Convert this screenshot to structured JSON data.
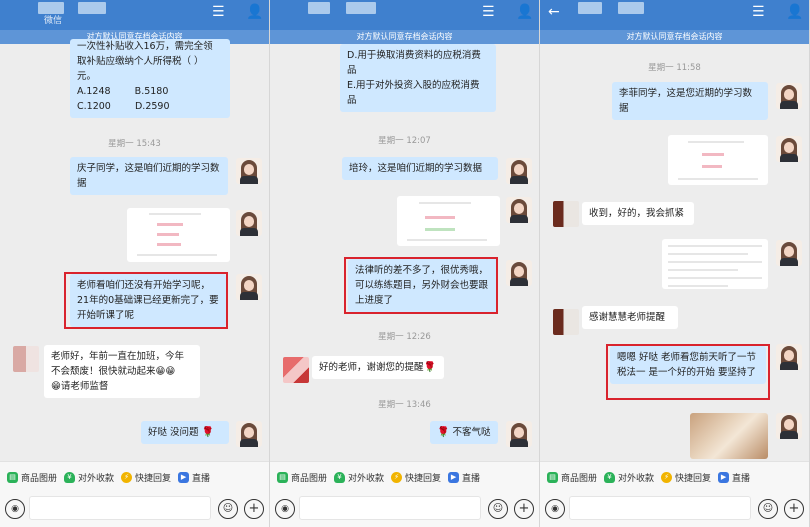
{
  "topbar": {
    "title1": "微信",
    "notice": "对方默认同意存档会话内容"
  },
  "panel1": {
    "q_lines": [
      "一次性补贴收入16万，需完全领",
      "取补贴应缴纳个人所得税（ ）",
      "元。",
      "A.1248        B.5180",
      "C.1200        D.2590"
    ],
    "stamp1": "星期一 15:43",
    "msg1": "庆子同学，这是咱们近期的学习数据",
    "msg2": "老师看咱们还没有开始学习呢，21年的0基础课已经更新完了，要开始听课了呢",
    "msg3_line1": "老师好，年前一直在加班，今年不会颓废！很快就动起来😁😁",
    "msg3_line2": "😁请老师监督",
    "msg4": "好哒 没问题"
  },
  "panel2": {
    "q_lines": [
      "D.用于换取消费资料的应税消费",
      "品",
      "E.用于对外投资入股的应税消费",
      "品"
    ],
    "stamp1": "星期一 12:07",
    "msg1": "培玲，这是咱们近期的学习数据",
    "msg2": "法律听的差不多了，很优秀哦，可以练练题目，另外财会也要跟上进度了",
    "stamp2": "星期一 12:26",
    "msg3": "好的老师，谢谢您的提醒",
    "stamp3": "星期一 13:46",
    "msg4": "不客气哒"
  },
  "panel3": {
    "notice": "对方默认同意存档会话内容",
    "stamp1": "星期一 11:58",
    "msg1": "李菲同学，这是您近期的学习数据",
    "msg2": "收到，好的，我会抓紧",
    "msg3": "感谢慧慧老师提醒",
    "msg4": "嗯嗯 好哒 老师看您前天听了一节税法一 是一个好的开始 要坚持了"
  },
  "tools": [
    "商品图册",
    "对外收款",
    "快捷回复",
    "直播"
  ],
  "icons": {
    "menu": "list-icon",
    "user": "user-icon",
    "back": "back-arrow-icon",
    "voice": "voice-icon",
    "emoji": "emoji-icon",
    "plus": "plus-icon",
    "flower": "rose-icon"
  },
  "colors": {
    "header": "#3f80ce",
    "bubble_self": "#cfe8ff",
    "highlight": "#d9232d"
  }
}
